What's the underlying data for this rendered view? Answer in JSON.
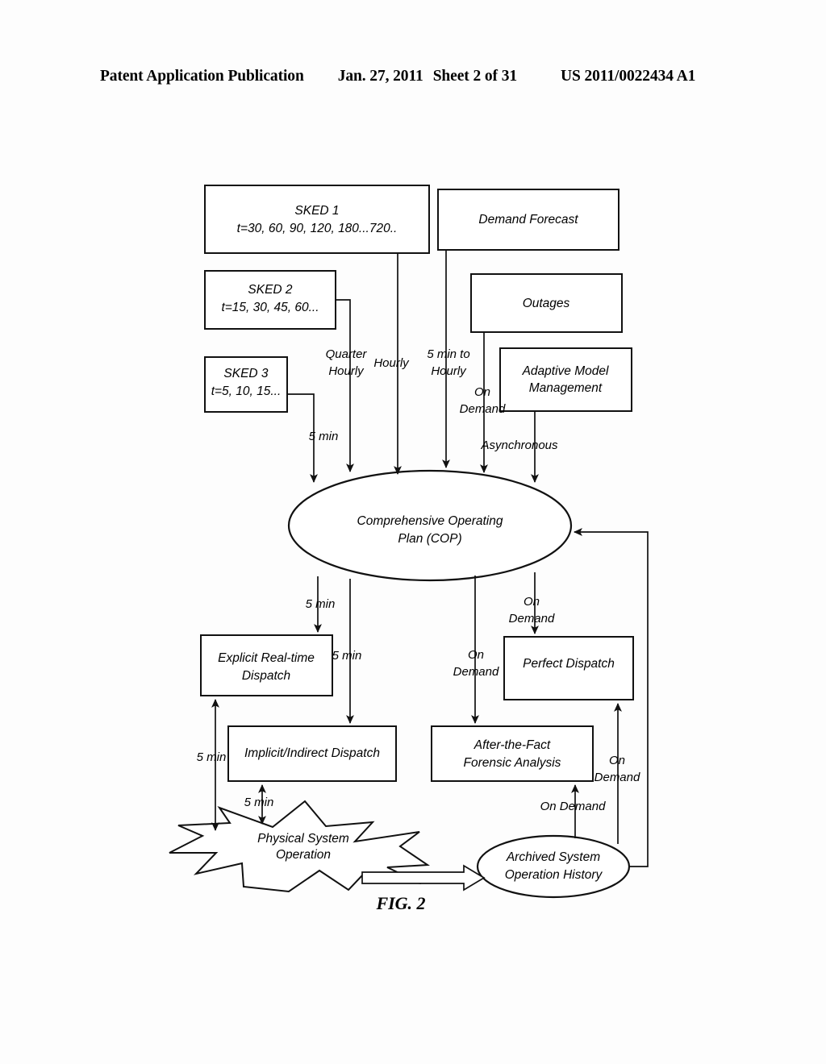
{
  "header": {
    "publication": "Patent Application Publication",
    "date": "Jan. 27, 2011",
    "sheet": "Sheet 2 of 31",
    "patent_number": "US 2011/0022434 A1"
  },
  "figure": {
    "caption": "FIG. 2",
    "nodes": {
      "sked1_title": "SKED 1",
      "sked1_detail": "t=30, 60, 90, 120, 180...720..",
      "sked2_title": "SKED 2",
      "sked2_detail": "t=15, 30, 45, 60...",
      "sked3_title": "SKED 3",
      "sked3_detail": "t=5, 10, 15...",
      "demand_forecast": "Demand Forecast",
      "outages": "Outages",
      "adaptive_model_line1": "Adaptive Model",
      "adaptive_model_line2": "Management",
      "cop_line1": "Comprehensive Operating",
      "cop_line2": "Plan (COP)",
      "explicit_dispatch_line1": "Explicit Real-time",
      "explicit_dispatch_line2": "Dispatch",
      "implicit_dispatch": "Implicit/Indirect Dispatch",
      "perfect_dispatch": "Perfect Dispatch",
      "forensic_line1": "After-the-Fact",
      "forensic_line2": "Forensic Analysis",
      "physical_system_line1": "Physical System",
      "physical_system_line2": "Operation",
      "archive_line1": "Archived System",
      "archive_line2": "Operation History"
    },
    "edge_labels": {
      "sked3_to_cop": "5 min",
      "sked2_to_cop_line1": "Quarter",
      "sked2_to_cop_line2": "Hourly",
      "sked1_to_cop": "Hourly",
      "forecast_to_cop_line1": "5 min to",
      "forecast_to_cop_line2": "Hourly",
      "outages_to_cop_line1": "On",
      "outages_to_cop_line2": "Demand",
      "adaptive_to_cop": "Asynchronous",
      "cop_to_explicit": "5 min",
      "cop_to_implicit": "5 min",
      "cop_to_forensic_line1": "On",
      "cop_to_forensic_line2": "Demand",
      "cop_to_perfect_line1": "On",
      "cop_to_perfect_line2": "Demand",
      "physical_to_explicit": "5 min",
      "implicit_to_physical": "5 min",
      "archive_to_forensic": "On Demand",
      "archive_to_perfect_line1": "On",
      "archive_to_perfect_line2": "Demand"
    }
  }
}
